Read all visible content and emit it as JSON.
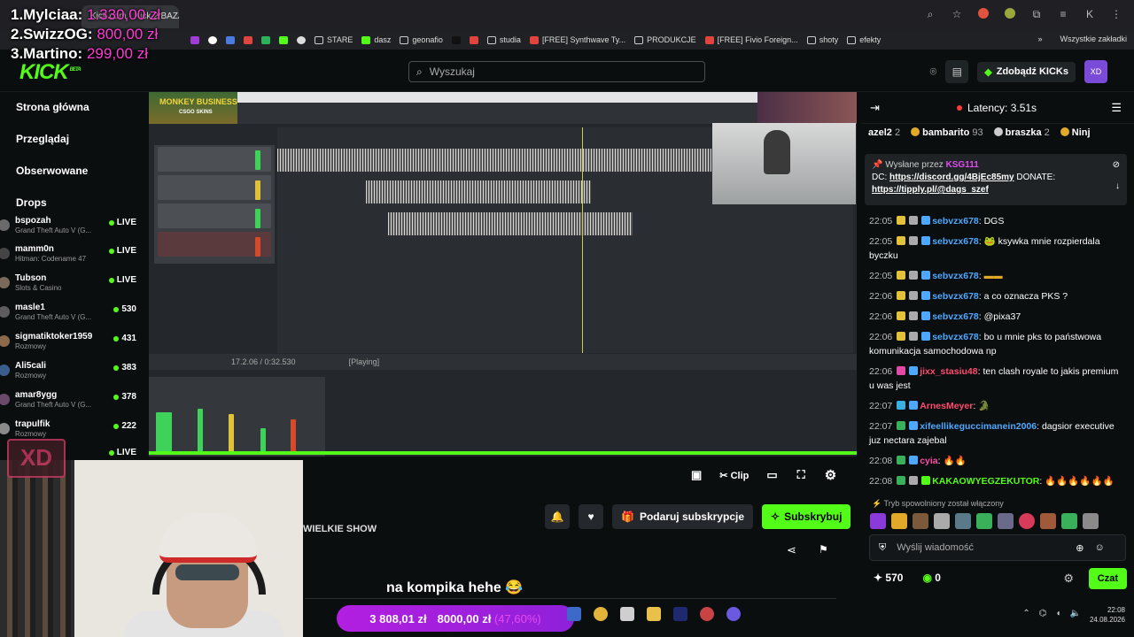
{
  "browser": {
    "tab_title": "Kick.com - Kick 2 BAZARE",
    "bookmarks": [
      "STARE",
      "dasz",
      "geonafio",
      "studia",
      "[FREE] Synthwave Ty...",
      "PRODUKCJE",
      "[FREE] Fivio Foreign...",
      "shoty",
      "efekty"
    ],
    "bookmarks_end": "Wszystkie zakładki",
    "profile_letter": "K"
  },
  "leaderboard": [
    {
      "name": "1.Mylciaa:",
      "amount": "1.330,00 zł",
      "color": "#ff3bd4"
    },
    {
      "name": "2.SwizzOG:",
      "amount": "800,00 zł",
      "color": "#ff3bd4"
    },
    {
      "name": "3.Martino:",
      "amount": "299,00 zł",
      "color": "#ff3bd4"
    }
  ],
  "kick": {
    "logo": "KICK",
    "logo_sup": "BETA",
    "search_placeholder": "Wyszukaj",
    "kicks_button": "Zdobądź KICKs"
  },
  "sidebar": {
    "nav": [
      "Strona główna",
      "Przeglądaj",
      "Obserwowane",
      "Drops"
    ],
    "channels": [
      {
        "name": "bspozah",
        "game": "Grand Theft Auto V (G...",
        "viewers": "LIVE",
        "avatar": "#6a6a6a"
      },
      {
        "name": "mamm0n",
        "game": "Hitman: Codename 47",
        "viewers": "LIVE",
        "avatar": "#444"
      },
      {
        "name": "Tubson",
        "game": "Slots & Casino",
        "viewers": "LIVE",
        "avatar": "#7a6a5a"
      },
      {
        "name": "masle1",
        "game": "Grand Theft Auto V (G...",
        "viewers": "530",
        "avatar": "#5c5c5c"
      },
      {
        "name": "sigmatiktoker1959",
        "game": "Rozmowy",
        "viewers": "431",
        "avatar": "#8a6a4a"
      },
      {
        "name": "Ali5cali",
        "game": "Rozmowy",
        "viewers": "383",
        "avatar": "#3b5d8c"
      },
      {
        "name": "amar8ygg",
        "game": "Grand Theft Auto V (G...",
        "viewers": "378",
        "avatar": "#6a4a6a"
      },
      {
        "name": "trapulfik",
        "game": "Rozmowy",
        "viewers": "222",
        "avatar": "#8a8a8a"
      },
      {
        "name": "",
        "game": "",
        "viewers": "LIVE",
        "avatar": "#3d1d24"
      }
    ]
  },
  "stream": {
    "daw_thumb": "MONKEY BUSINESS",
    "daw_thumb2": "CSGO SKINS",
    "transport_time": "17.2.06 / 0:32.530",
    "transport_state": "[Playing]",
    "clip_label": "Clip"
  },
  "below_video": {
    "title": "WIELKIE SHOW",
    "gift_sub": "Podaruj subskrypcje",
    "subscribe": "Subskrybuj",
    "caption": "na kompika hehe 😂"
  },
  "donation": {
    "current": "3 808,01 zł",
    "goal": "8000,00 zł",
    "percent": "(47,60%)",
    "progress": 0.476
  },
  "taskbar": {
    "time": "22:08",
    "date": "24.08.2026"
  },
  "chat": {
    "latency": "Latency: 3.51s",
    "top_gifters": [
      {
        "name": "azel2",
        "count": "2",
        "color": "#aaaaaa"
      },
      {
        "name": "bambarito",
        "count": "93",
        "color": "#e2a928"
      },
      {
        "name": "braszka",
        "count": "2",
        "color": "#cccccc"
      },
      {
        "name": "Ninj",
        "count": "",
        "color": "#e2a928"
      }
    ],
    "pinned": {
      "by_label": "Wysłane przez",
      "by_user": "KSG111",
      "text1": "DC:",
      "link1": "https://discord.gg/4BjEc85my",
      "text2": "DONATE:",
      "link2": "https://tipply.pl/@dags_szef"
    },
    "messages": [
      {
        "time": "22:05",
        "user": "sebvzx678",
        "color": "#4fa8ff",
        "text": "DGS"
      },
      {
        "time": "22:05",
        "user": "sebvzx678",
        "color": "#4fa8ff",
        "text": "🐸 ksywka mnie rozpierdala byczku"
      },
      {
        "time": "22:05",
        "user": "sebvzx678",
        "color": "#4fa8ff",
        "text": "▬▬"
      },
      {
        "time": "22:06",
        "user": "sebvzx678",
        "color": "#4fa8ff",
        "text": "a co oznacza PKS ?"
      },
      {
        "time": "22:06",
        "user": "sebvzx678",
        "color": "#4fa8ff",
        "text": "@pixa37"
      },
      {
        "time": "22:06",
        "user": "sebvzx678",
        "color": "#4fa8ff",
        "text": "bo u mnie pks to państwowa komunikacja samochodowa np"
      },
      {
        "time": "22:06",
        "user": "jixx_stasiu48",
        "color": "#ff4a6e",
        "text": "ten clash royale to jakis premium u was jest"
      },
      {
        "time": "22:07",
        "user": "ArnesMeyer",
        "color": "#ff4a6e",
        "text": "🐊"
      },
      {
        "time": "22:07",
        "user": "xifeellikeguccimanein2006",
        "color": "#4fa8ff",
        "text": "dagsior executive juz nectara zajebal"
      },
      {
        "time": "22:08",
        "user": "cyia",
        "color": "#ff4aa8",
        "text": "🔥🔥"
      },
      {
        "time": "22:08",
        "user": "KAKAOWYEGZEKUTOR",
        "color": "#53fc18",
        "text": "🔥🔥🔥🔥🔥🔥"
      }
    ],
    "slow_mode": "Tryb spowolniony został włączony",
    "input_placeholder": "Wyślij wiadomość",
    "kicks_count": "570",
    "points": "0",
    "send_label": "Czat"
  }
}
